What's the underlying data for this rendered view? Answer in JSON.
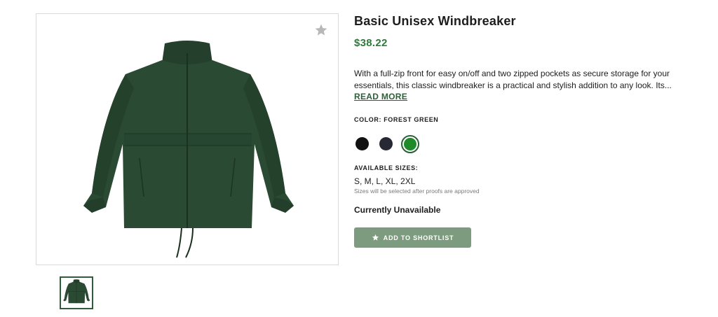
{
  "product": {
    "title": "Basic Unisex Windbreaker",
    "price": "$38.22",
    "description": "With a full-zip front for easy on/off and two zipped pockets as secure storage for your essentials, this classic windbreaker is a practical and stylish addition to any look. Its...",
    "read_more": "READ MORE",
    "color_label": "COLOR: FOREST GREEN",
    "colors": [
      {
        "name": "black",
        "hex": "#111111",
        "selected": false
      },
      {
        "name": "navy",
        "hex": "#262833",
        "selected": false
      },
      {
        "name": "forest-green",
        "hex": "#1f8a2a",
        "selected": true
      }
    ],
    "sizes_label": "AVAILABLE SIZES:",
    "sizes": "S, M, L, XL, 2XL",
    "sizes_note": "Sizes will be selected after proofs are approved",
    "availability": "Currently Unavailable",
    "shortlist_button": "ADD TO SHORTLIST"
  },
  "gallery": {
    "main_icon": "star-icon",
    "thumbnail_count": 1,
    "jacket_color": "#2a4a33"
  },
  "colors": {
    "price": "#2d7a3a",
    "accent": "#2e5e39",
    "button_bg": "#7d9c7f"
  }
}
